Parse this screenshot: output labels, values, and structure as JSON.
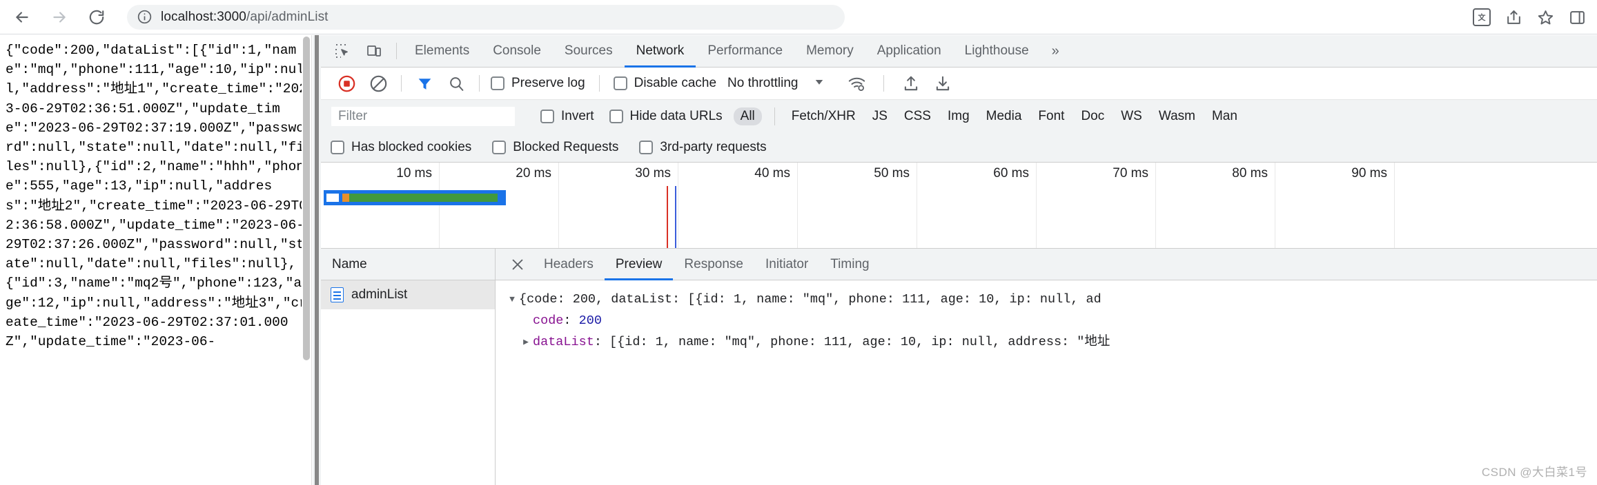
{
  "browser": {
    "back_label": "Back",
    "forward_label": "Forward",
    "reload_label": "Reload",
    "site_info_label": "View site information",
    "url_host": "localhost:3000",
    "url_path": "/api/adminList",
    "translate_label": "Translate this page",
    "share_label": "Share this page",
    "bookmark_label": "Bookmark this tab",
    "sidepanel_label": "Side panel"
  },
  "response_body": "{\"code\":200,\"dataList\":[{\"id\":1,\"name\":\"mq\",\"phone\":111,\"age\":10,\"ip\":null,\"address\":\"地址1\",\"create_time\":\"2023-06-29T02:36:51.000Z\",\"update_time\":\"2023-06-29T02:37:19.000Z\",\"password\":null,\"state\":null,\"date\":null,\"files\":null},{\"id\":2,\"name\":\"hhh\",\"phone\":555,\"age\":13,\"ip\":null,\"address\":\"地址2\",\"create_time\":\"2023-06-29T02:36:58.000Z\",\"update_time\":\"2023-06-29T02:37:26.000Z\",\"password\":null,\"state\":null,\"date\":null,\"files\":null},{\"id\":3,\"name\":\"mq2号\",\"phone\":123,\"age\":12,\"ip\":null,\"address\":\"地址3\",\"create_time\":\"2023-06-29T02:37:01.000Z\",\"update_time\":\"2023-06-",
  "devtools": {
    "inspect_icon_label": "Inspect element",
    "device_icon_label": "Toggle device toolbar",
    "tabs": [
      {
        "label": "Elements",
        "active": false
      },
      {
        "label": "Console",
        "active": false
      },
      {
        "label": "Sources",
        "active": false
      },
      {
        "label": "Network",
        "active": true
      },
      {
        "label": "Performance",
        "active": false
      },
      {
        "label": "Memory",
        "active": false
      },
      {
        "label": "Application",
        "active": false
      },
      {
        "label": "Lighthouse",
        "active": false
      }
    ],
    "more_tabs": "»",
    "toolbar": {
      "record_label": "Stop recording network log",
      "clear_label": "Clear network log",
      "filter_label": "Filter",
      "search_label": "Search",
      "preserve_log": "Preserve log",
      "disable_cache": "Disable cache",
      "throttling": "No throttling",
      "network_conditions_label": "Network conditions",
      "import_har_label": "Import HAR file",
      "export_har_label": "Export HAR file"
    },
    "filterbar": {
      "filter_placeholder": "Filter",
      "filter_value": "",
      "invert": "Invert",
      "hide_data_urls": "Hide data URLs",
      "types": [
        {
          "label": "All",
          "active": true
        },
        {
          "label": "Fetch/XHR",
          "active": false
        },
        {
          "label": "JS",
          "active": false
        },
        {
          "label": "CSS",
          "active": false
        },
        {
          "label": "Img",
          "active": false
        },
        {
          "label": "Media",
          "active": false
        },
        {
          "label": "Font",
          "active": false
        },
        {
          "label": "Doc",
          "active": false
        },
        {
          "label": "WS",
          "active": false
        },
        {
          "label": "Wasm",
          "active": false
        },
        {
          "label": "Man",
          "active": false
        }
      ],
      "has_blocked_cookies": "Has blocked cookies",
      "blocked_requests": "Blocked Requests",
      "third_party_requests": "3rd-party requests"
    },
    "overview": {
      "ticks": [
        "10 ms",
        "20 ms",
        "30 ms",
        "40 ms",
        "50 ms",
        "60 ms",
        "70 ms",
        "80 ms",
        "90 ms"
      ],
      "bar_color_outer": "#1a73e8",
      "bar_color_wait": "#e8902a",
      "bar_color_download": "#41993d",
      "dom_content_loaded_color": "#3b5ddb",
      "load_event_color": "#d93025"
    },
    "request_list": {
      "column_name": "Name",
      "rows": [
        {
          "name": "adminList",
          "icon": "document-icon",
          "selected": true
        }
      ]
    },
    "detail": {
      "close_label": "×",
      "tabs": [
        {
          "label": "Headers",
          "active": false
        },
        {
          "label": "Preview",
          "active": true
        },
        {
          "label": "Response",
          "active": false
        },
        {
          "label": "Initiator",
          "active": false
        },
        {
          "label": "Timing",
          "active": false
        }
      ],
      "preview": {
        "line1": "{code: 200, dataList: [{id: 1, name: \"mq\", phone: 111, age: 10, ip: null, ad",
        "line2_key": "code",
        "line2_value": "200",
        "line3_key": "dataList",
        "line3_value": "[{id: 1, name: \"mq\", phone: 111, age: 10, ip: null, address: \"地址"
      }
    }
  },
  "watermark": "CSDN @大白菜1号"
}
